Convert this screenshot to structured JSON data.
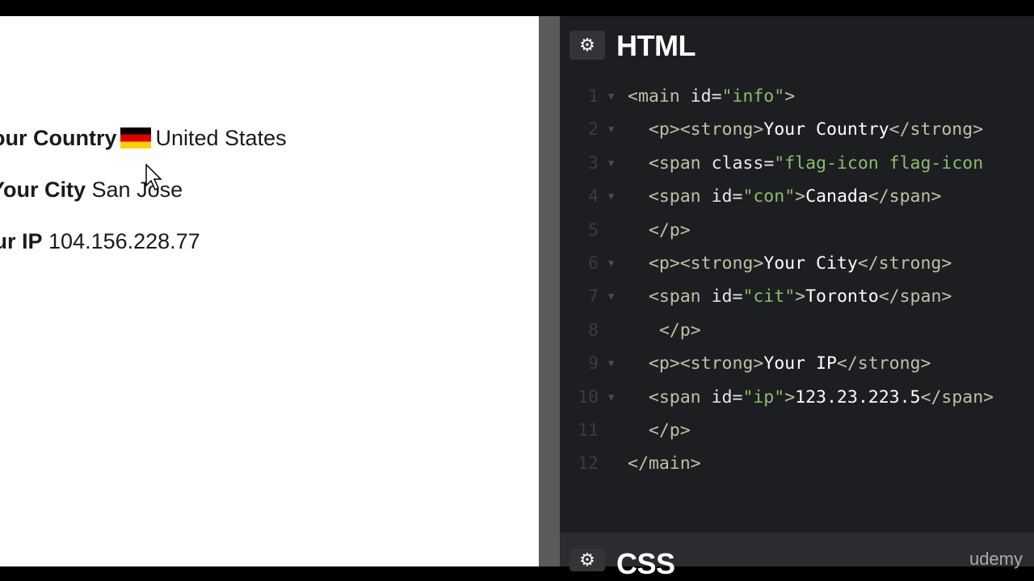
{
  "preview": {
    "country_label": "Your Country",
    "country_value": "United States",
    "city_label": "Your City",
    "city_value": "San Jose",
    "ip_label": "Your IP",
    "ip_value": "104.156.228.77"
  },
  "editor": {
    "html_title": "HTML",
    "css_title": "CSS",
    "lines": [
      {
        "n": "1",
        "code": "<main id=\"info\">"
      },
      {
        "n": "2",
        "code": "  <p><strong>Your Country</strong>"
      },
      {
        "n": "3",
        "code": "  <span class=\"flag-icon flag-icon"
      },
      {
        "n": "4",
        "code": "  <span id=\"con\">Canada</span>"
      },
      {
        "n": "5",
        "code": "  </p>"
      },
      {
        "n": "6",
        "code": "  <p><strong>Your City</strong>"
      },
      {
        "n": "7",
        "code": "  <span id=\"cit\">Toronto</span>"
      },
      {
        "n": "8",
        "code": "   </p>"
      },
      {
        "n": "9",
        "code": "  <p><strong>Your IP</strong>"
      },
      {
        "n": "10",
        "code": "  <span id=\"ip\">123.23.223.5</span>"
      },
      {
        "n": "11",
        "code": "  </p>"
      },
      {
        "n": "12",
        "code": "</main>"
      }
    ]
  },
  "watermark": "udemy",
  "icons": {
    "settings": "gear-icon",
    "fold": "fold-arrow-icon",
    "cursor": "mouse-cursor-icon",
    "flag": "germany-flag-icon"
  }
}
